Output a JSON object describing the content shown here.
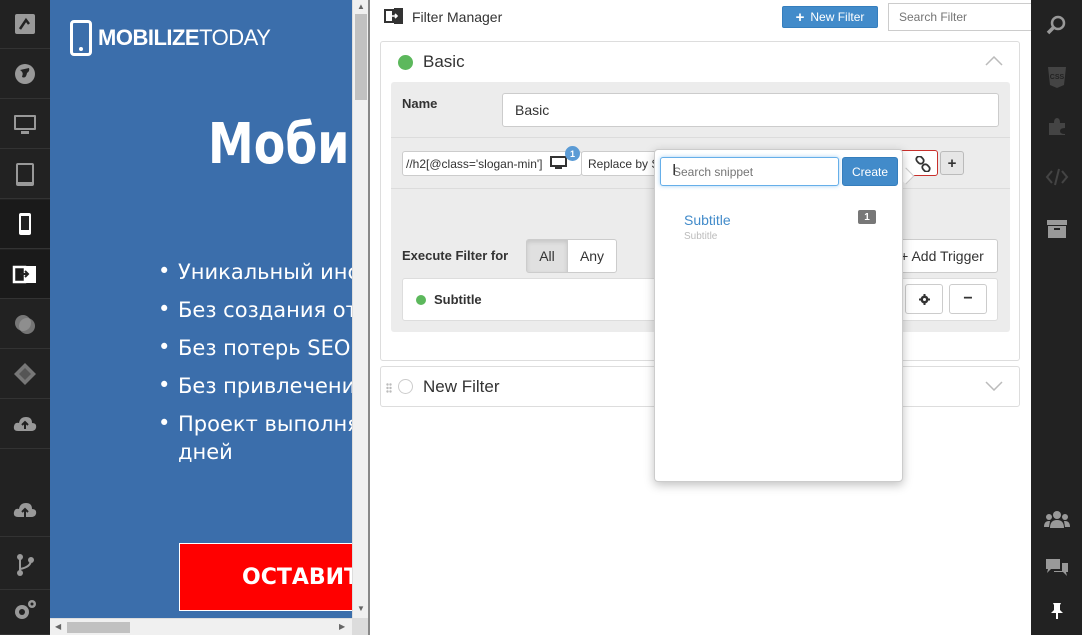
{
  "left_sidebar": {
    "items": [
      {
        "icon": "rotate-device-icon"
      },
      {
        "icon": "globe-icon"
      },
      {
        "icon": "desktop-icon"
      },
      {
        "icon": "tablet-icon"
      },
      {
        "icon": "mobile-icon"
      },
      {
        "icon": "filter-manager-icon"
      },
      {
        "icon": "circles-icon"
      },
      {
        "icon": "puzzle-icon"
      },
      {
        "icon": "cloud-upload-icon"
      },
      {
        "icon": "cloud-publish-icon"
      },
      {
        "icon": "branch-icon"
      },
      {
        "icon": "gears-icon"
      }
    ]
  },
  "preview": {
    "logo_bold": "MOBILIZE",
    "logo_light": "TODAY",
    "title": "Мобил",
    "bullets": [
      "Уникальный инст",
      "Без создания отд",
      "Без потерь SEO-п",
      "Без привлечения",
      "Проект выполняе"
    ],
    "bullet_continuation": "дней",
    "cta_label": "ОСТАВИТЬ",
    "bg_color": "#3b6eab",
    "cta_color": "#ff0000"
  },
  "header": {
    "title": "Filter Manager",
    "new_filter_label": "New Filter",
    "search_placeholder": "Search Filter"
  },
  "filters": [
    {
      "name": "Basic",
      "active": true,
      "expanded": true,
      "name_label": "Name",
      "name_value": "Basic",
      "rule": {
        "xpath": "//h2[@class='slogan-min']",
        "match_count": "1",
        "action": "Replace by Snippet"
      },
      "execute_label": "Execute Filter for",
      "execute_options": [
        "All",
        "Any"
      ],
      "execute_selected": "All",
      "add_trigger_label": "+ Add Trigger",
      "triggers": [
        {
          "name": "Subtitle",
          "active": true
        }
      ]
    },
    {
      "name": "New Filter",
      "active": false,
      "expanded": false
    }
  ],
  "snippet_popover": {
    "search_placeholder": "Search snippet",
    "create_label": "Create",
    "items": [
      {
        "title": "Subtitle",
        "subtitle": "Subtitle",
        "count": "1"
      }
    ]
  },
  "right_sidebar": {
    "items": [
      {
        "icon": "search-icon"
      },
      {
        "icon": "css-icon",
        "label": "CSS"
      },
      {
        "icon": "puzzle-icon"
      },
      {
        "icon": "code-icon"
      },
      {
        "icon": "archive-icon"
      },
      {
        "icon": "users-icon"
      },
      {
        "icon": "comments-icon"
      },
      {
        "icon": "pin-icon"
      }
    ]
  },
  "colors": {
    "accent": "#428bca",
    "active_green": "#5cb85c",
    "sidebar_bg": "#222222"
  }
}
